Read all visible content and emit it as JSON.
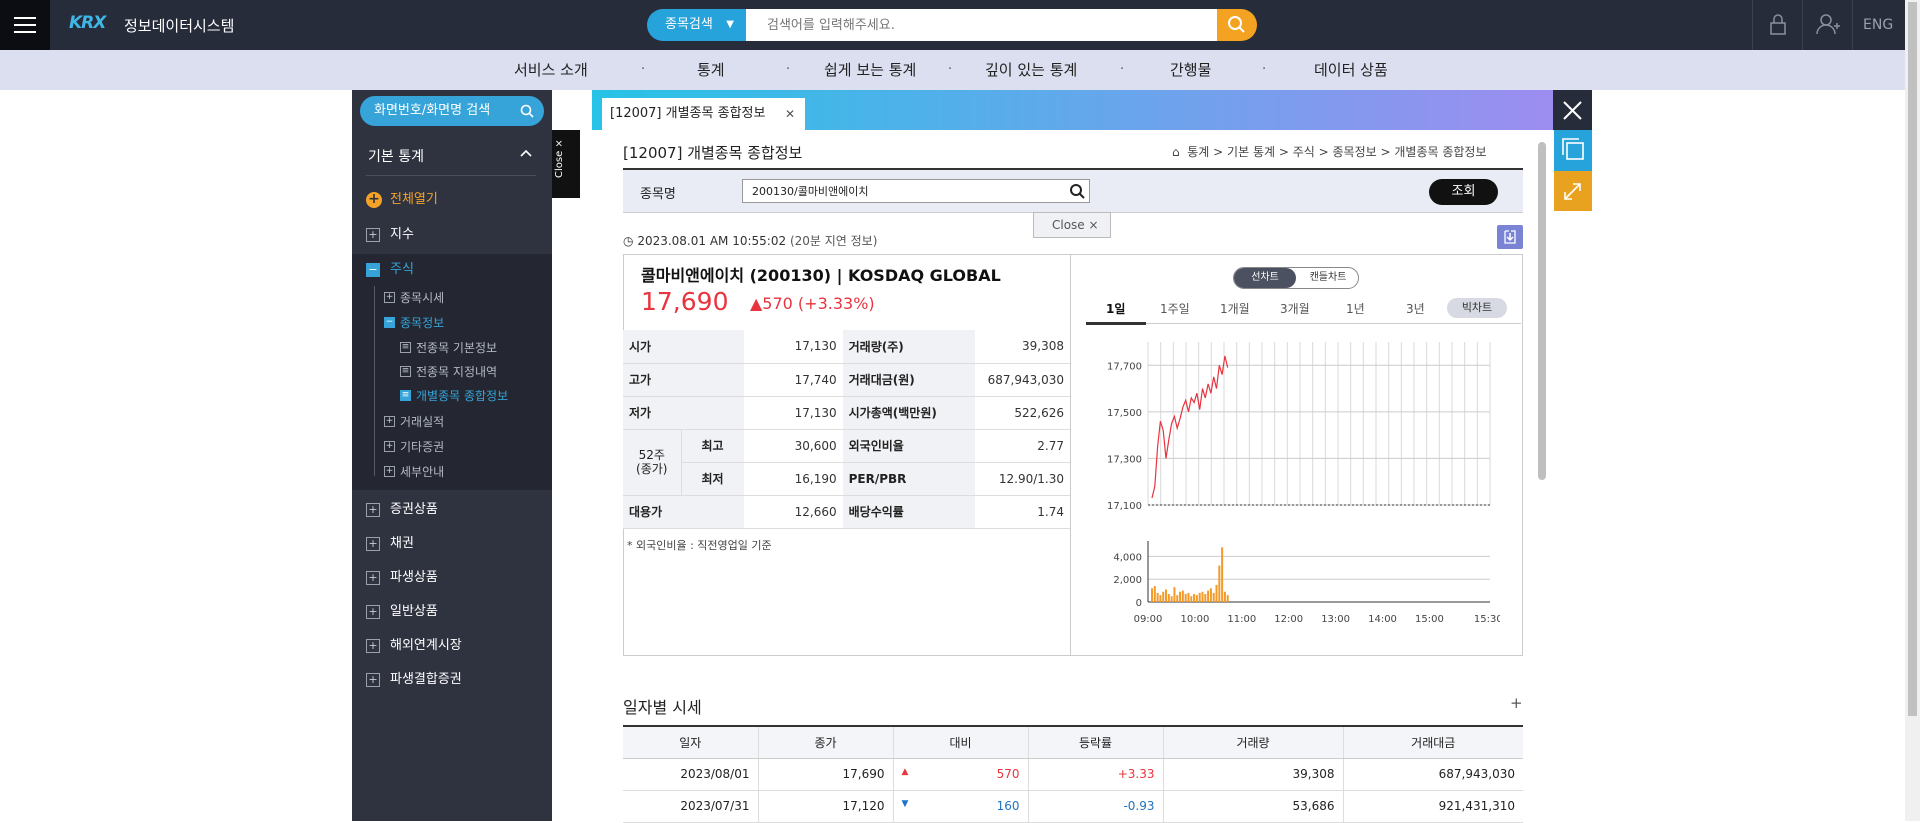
{
  "header": {
    "logo_mark": "KRX",
    "logo_text": "정보데이터시스템",
    "search_type": "종목검색",
    "search_placeholder": "검색어를 입력해주세요.",
    "lang": "ENG"
  },
  "nav": [
    "서비스 소개",
    "통계",
    "쉽게 보는 통계",
    "깊이 있는 통계",
    "간행물",
    "데이터 상품"
  ],
  "sidebar": {
    "search_label": "화면번호/화면명 검색",
    "title": "기본 통계",
    "open_all": "전체열기",
    "close_label": "Close ×",
    "items": [
      "지수",
      "주식",
      "증권상품",
      "채권",
      "파생상품",
      "일반상품",
      "해외연계시장",
      "파생결합증권"
    ],
    "stock_sub": [
      "종목시세",
      "종목정보",
      "거래실적",
      "기타증권",
      "세부안내"
    ],
    "info_sub": [
      "전종목 기본정보",
      "전종목 지정내역",
      "개별종목 종합정보"
    ]
  },
  "tab": {
    "label": "[12007] 개별종목 종합정보"
  },
  "page": {
    "title": "[12007] 개별종목 종합정보",
    "breadcrumb": [
      "통계",
      "기본 통계",
      "주식",
      "종목정보",
      "개별종목 종합정보"
    ]
  },
  "filter": {
    "label": "종목명",
    "stock_value": "200130/콜마비앤에이치",
    "query_button": "조회",
    "close_popup": "Close ×"
  },
  "quote": {
    "timestamp": "2023.08.01 AM 10:55:02",
    "delay_note": "(20분 지연 정보)",
    "name": "콜마비앤에이치 (200130) | KOSDAQ GLOBAL",
    "price": "17,690",
    "change": "▲570 (+3.33%)",
    "rows": [
      {
        "l1": "시가",
        "v1": "17,130",
        "l2": "거래량(주)",
        "v2": "39,308"
      },
      {
        "l1": "고가",
        "v1": "17,740",
        "l2": "거래대금(원)",
        "v2": "687,943,030"
      },
      {
        "l1": "저가",
        "v1": "17,130",
        "l2": "시가총액(백만원)",
        "v2": "522,626"
      },
      {
        "l1": "최고",
        "v1": "30,600",
        "l2": "외국인비율",
        "v2": "2.77"
      },
      {
        "l1": "최저",
        "v1": "16,190",
        "l2": "PER/PBR",
        "v2": "12.90/1.30"
      },
      {
        "l1": "대용가",
        "v1": "12,660",
        "l2": "배당수익률",
        "v2": "1.74"
      }
    ],
    "week52": "52주\n(종가)",
    "note": "* 외국인비율 : 직전영업일 기준"
  },
  "chart_toggle": {
    "on": "선차트",
    "off": "캔들차트"
  },
  "periods": [
    "1일",
    "1주일",
    "1개월",
    "3개월",
    "1년",
    "3년"
  ],
  "big_chart": "빅차트",
  "chart_data": {
    "type": "line",
    "price_axis": {
      "ticks": [
        "17,700",
        "17,500",
        "17,300",
        "17,100"
      ],
      "ylim": [
        17100,
        17800
      ]
    },
    "volume_axis": {
      "ticks": [
        "4,000",
        "2,000",
        "0"
      ],
      "ylim": [
        0,
        5000
      ]
    },
    "time_ticks": [
      "09:00",
      "10:00",
      "11:00",
      "12:00",
      "13:00",
      "14:00",
      "15:00",
      "15:30"
    ],
    "price_series": [
      17130,
      17180,
      17350,
      17460,
      17420,
      17300,
      17380,
      17450,
      17480,
      17430,
      17470,
      17520,
      17550,
      17500,
      17560,
      17540,
      17580,
      17510,
      17600,
      17560,
      17620,
      17580,
      17650,
      17600,
      17700,
      17660,
      17740,
      17690
    ],
    "volume_series": [
      1200,
      1400,
      800,
      600,
      900,
      1100,
      700,
      500,
      1300,
      600,
      900,
      1000,
      700,
      800,
      500,
      700,
      600,
      800,
      900,
      700,
      1000,
      1200,
      800,
      1500,
      3200,
      4800,
      900,
      600
    ],
    "series_color": "#e7343f",
    "volume_color": "#f29b2b"
  },
  "daily": {
    "title": "일자별 시세",
    "plus": "+",
    "columns": [
      "일자",
      "종가",
      "대비",
      "등락률",
      "거래량",
      "거래대금"
    ],
    "rows": [
      {
        "date": "2023/08/01",
        "close": "17,690",
        "dir": "▲",
        "diff": "570",
        "rate": "+3.33",
        "vol": "39,308",
        "amt": "687,943,030",
        "cls": "up"
      },
      {
        "date": "2023/07/31",
        "close": "17,120",
        "dir": "▼",
        "diff": "160",
        "rate": "-0.93",
        "vol": "53,686",
        "amt": "921,431,310",
        "cls": "down"
      }
    ]
  },
  "colors": {
    "accent": "#27a3dc",
    "search_button": "#f3a321",
    "up": "#e7343f",
    "down": "#1f73c4"
  }
}
